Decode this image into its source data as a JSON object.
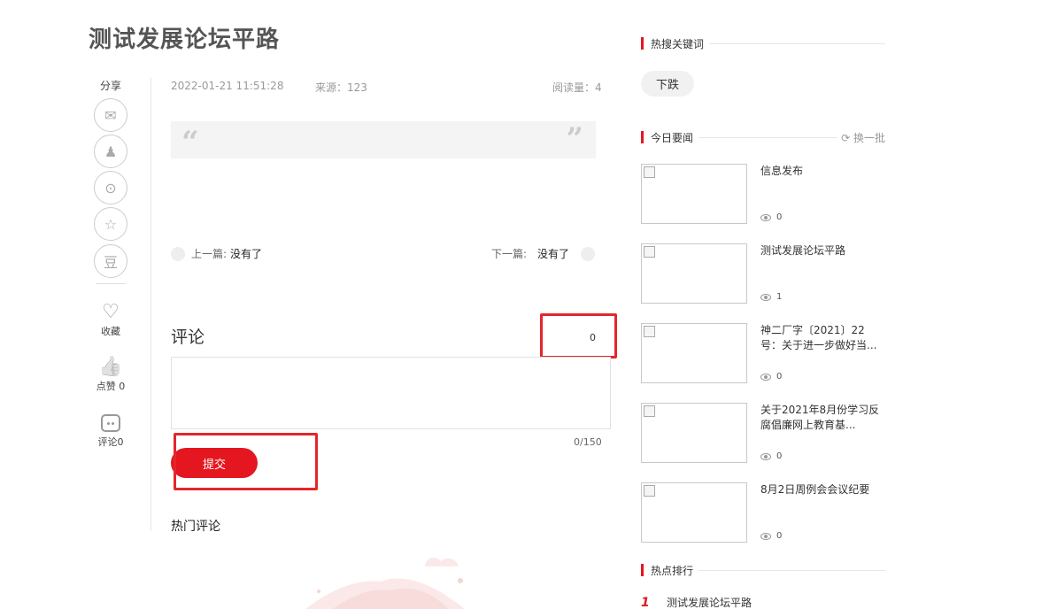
{
  "article": {
    "title": "测试发展论坛平路",
    "date": "2022-01-21 11:51:28",
    "source": "来源：123",
    "reads": "阅读量：4",
    "quote_open": "“",
    "quote_close": "”"
  },
  "share": {
    "label": "分享",
    "wechat_glyph": "✉",
    "qq_glyph": "♟",
    "weibo_glyph": "⊙",
    "qzone_glyph": "☆",
    "douban_glyph": "豆",
    "favorite": {
      "icon": "♡",
      "label": "收藏"
    },
    "like": {
      "icon": "👍",
      "label": "点赞 0"
    },
    "comment": {
      "label": "评论0"
    }
  },
  "nav": {
    "prev_label": "上一篇:",
    "prev_value": "没有了",
    "next_label": "下一篇:",
    "next_value": "没有了"
  },
  "comments": {
    "title": "评论",
    "count": "0",
    "limit": "0/150",
    "submit_label": "提交",
    "hot_title": "热门评论"
  },
  "sidebar": {
    "hot_keywords": {
      "title": "热搜关键词",
      "tags": [
        "下跌"
      ]
    },
    "today_news": {
      "title": "今日要闻",
      "refresh_label": "换一批",
      "items": [
        {
          "title": "信息发布",
          "views": "0"
        },
        {
          "title": "测试发展论坛平路",
          "views": "1"
        },
        {
          "title": "神二厂字〔2021〕22号：关于进一步做好当...",
          "views": "0"
        },
        {
          "title": "关于2021年8月份学习反腐倡廉网上教育基...",
          "views": "0"
        },
        {
          "title": "8月2日周例会会议纪要",
          "views": "0"
        }
      ]
    },
    "hot_rank": {
      "title": "热点排行",
      "items": [
        {
          "num": "1",
          "title": "测试发展论坛平路"
        }
      ]
    }
  },
  "colors": {
    "accent": "#e4161f",
    "annotation": "#e4262b"
  }
}
